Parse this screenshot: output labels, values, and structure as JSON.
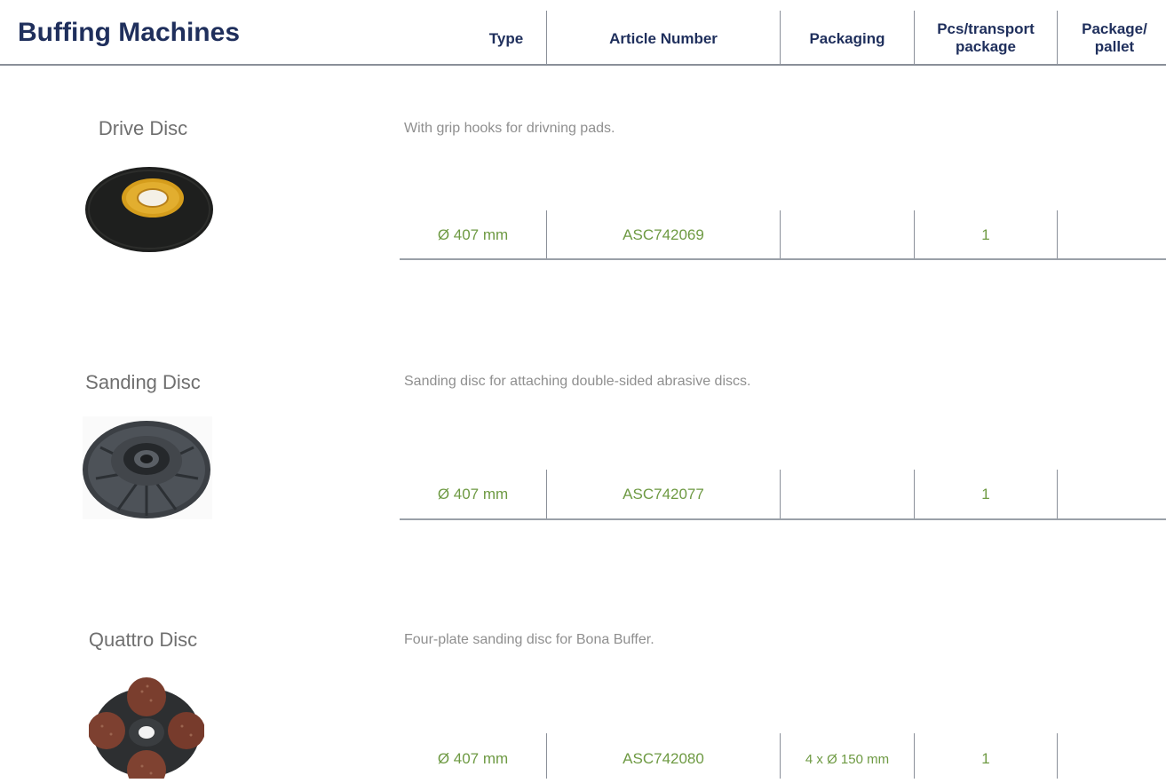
{
  "header": {
    "title": "Buffing Machines",
    "columns": [
      {
        "label": "Type"
      },
      {
        "label": "Article Number"
      },
      {
        "label": "Packaging"
      },
      {
        "label": "Pcs/transport package"
      },
      {
        "label": "Package/ pallet"
      }
    ]
  },
  "products": [
    {
      "name": "Drive Disc",
      "description": "With grip hooks for drivning pads.",
      "type": "Ø 407 mm",
      "article_number": "ASC742069",
      "packaging": "",
      "pcs_transport_package": "1",
      "package_pallet": "",
      "image": "drive-disc-photo"
    },
    {
      "name": "Sanding Disc",
      "description": "Sanding disc for attaching double-sided abrasive discs.",
      "type": "Ø 407 mm",
      "article_number": "ASC742077",
      "packaging": "",
      "pcs_transport_package": "1",
      "package_pallet": "",
      "image": "sanding-disc-photo"
    },
    {
      "name": "Quattro Disc",
      "description": "Four-plate sanding disc for Bona Buffer.",
      "type": "Ø 407 mm",
      "article_number": "ASC742080",
      "packaging": "4 x Ø 150 mm",
      "pcs_transport_package": "1",
      "package_pallet": "",
      "image": "quattro-disc-photo"
    }
  ],
  "colors": {
    "title": "#1f2f5c",
    "value_text": "#6e9a43",
    "product_name": "#6f6f6f",
    "rule": "#8a8f99"
  }
}
